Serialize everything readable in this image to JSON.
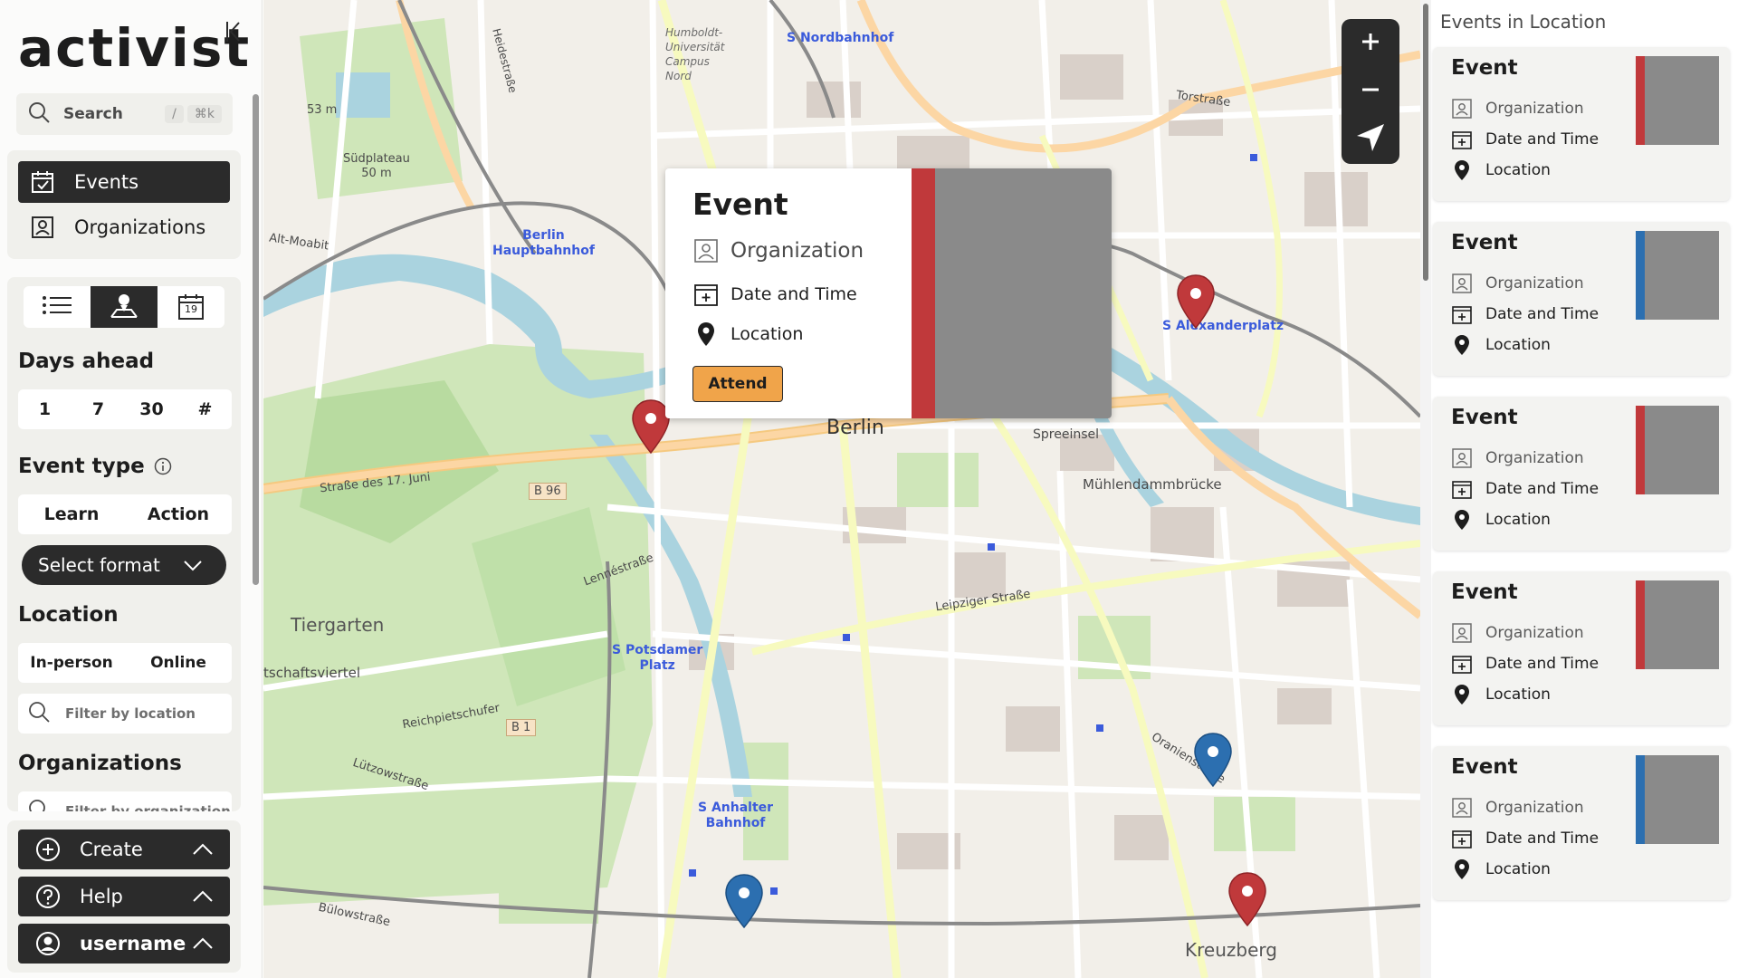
{
  "app": {
    "logo": "activist"
  },
  "search": {
    "label": "Search",
    "shortcut_slash": "/",
    "shortcut_cmd": "⌘k"
  },
  "nav": {
    "items": [
      {
        "label": "Events",
        "icon": "calendar-check-icon",
        "active": true
      },
      {
        "label": "Organizations",
        "icon": "organization-icon",
        "active": false
      }
    ]
  },
  "filters": {
    "view_modes": [
      "list-icon",
      "map-icon",
      "calendar-icon"
    ],
    "calendar_day": "19",
    "days_ahead": {
      "title": "Days ahead",
      "options": [
        "1",
        "7",
        "30",
        "#"
      ]
    },
    "event_type": {
      "title": "Event type",
      "options": [
        "Learn",
        "Action"
      ],
      "select_format": "Select format"
    },
    "location": {
      "title": "Location",
      "options": [
        "In-person",
        "Online"
      ],
      "placeholder": "Filter by location"
    },
    "organizations": {
      "title": "Organizations",
      "placeholder": "Filter by organization"
    }
  },
  "bottom": {
    "create": "Create",
    "help": "Help",
    "username": "username"
  },
  "map": {
    "labels": {
      "nordbahnhof": "S Nordbahnhof",
      "humboldt": "Humboldt-\nUniversität\nCampus\nNord",
      "hauptbahnhof": "Berlin\nHauptbahnhof",
      "alexanderplatz": "S Alexanderplatz",
      "berlin": "Berlin",
      "tiergarten": "Tiergarten",
      "potsdamer": "S Potsdamer\nPlatz",
      "anhalter": "S Anhalter\nBahnhof",
      "kreuzberg": "Kreuzberg",
      "leipziger": "Leipziger Straße",
      "muehlendamm": "Mühlendammbrücke",
      "spreeinsel": "Spreeinsel",
      "torstrasse": "Torstraße",
      "oranienstrasse": "Oranienstraße",
      "strasse17": "Straße des 17. Juni",
      "lennestrasse": "Lennéstraße",
      "reichpietschufer": "Reichpietschufer",
      "luetzow": "Lützowstraße",
      "buelow": "Bülowstraße",
      "alt_moabit": "Alt-Moabit",
      "suedplateau": "Südplateau\n50 m",
      "m53": "53 m",
      "b96": "B 96",
      "b1": "B 1",
      "heidestrasse": "Heidestraße",
      "schaftsviertel": "tschaftsviertel"
    }
  },
  "popup": {
    "title": "Event",
    "organization": "Organization",
    "date_time": "Date and Time",
    "location": "Location",
    "attend": "Attend",
    "accent": "#c0393b"
  },
  "right_panel": {
    "title": "Events in Location",
    "cards": [
      {
        "title": "Event",
        "organization": "Organization",
        "date_time": "Date and Time",
        "location": "Location",
        "accent": "#c0393b"
      },
      {
        "title": "Event",
        "organization": "Organization",
        "date_time": "Date and Time",
        "location": "Location",
        "accent": "#2c6fb0"
      },
      {
        "title": "Event",
        "organization": "Organization",
        "date_time": "Date and Time",
        "location": "Location",
        "accent": "#c0393b"
      },
      {
        "title": "Event",
        "organization": "Organization",
        "date_time": "Date and Time",
        "location": "Location",
        "accent": "#c0393b"
      },
      {
        "title": "Event",
        "organization": "Organization",
        "date_time": "Date and Time",
        "location": "Location",
        "accent": "#2c6fb0"
      }
    ]
  },
  "colors": {
    "dark": "#2b2b2b",
    "attend": "#f0a44a",
    "red_pin": "#c0393b",
    "blue_pin": "#2c6fb0"
  }
}
